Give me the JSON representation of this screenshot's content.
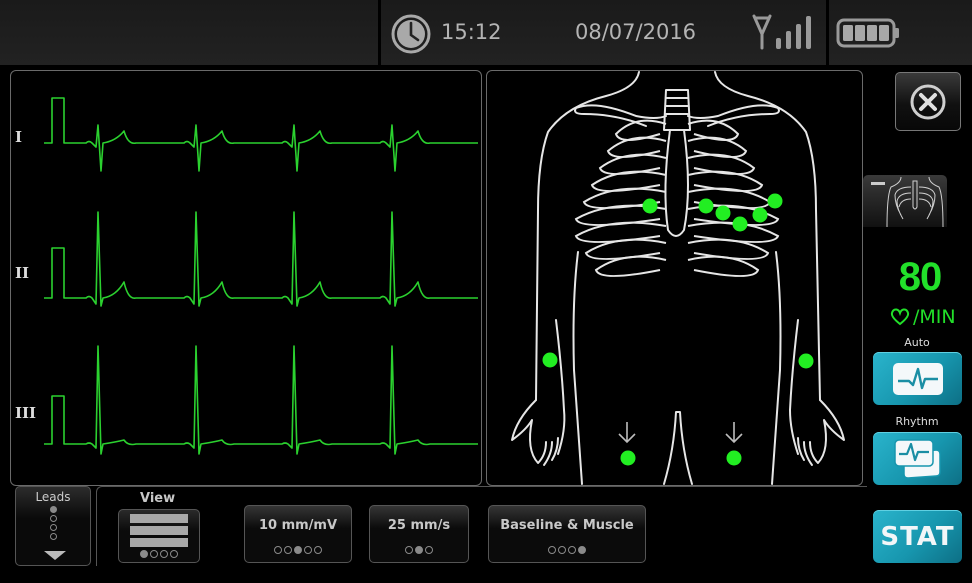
{
  "status_bar": {
    "time": "15:12",
    "date": "08/07/2016",
    "icons": [
      "clock-icon",
      "signal-icon",
      "battery-icon"
    ],
    "battery_level": 1.0,
    "signal_bars": 3
  },
  "leads_panel": {
    "leads": [
      {
        "label": "I"
      },
      {
        "label": "II"
      },
      {
        "label": "III"
      }
    ],
    "trace_color": "#2bd12f"
  },
  "body_panel": {
    "electrode_color": "#22ee22",
    "electrodes": [
      "RA",
      "LA",
      "V1",
      "V2",
      "V3",
      "V4",
      "V5",
      "V6",
      "RL",
      "LL"
    ]
  },
  "right_column": {
    "close_icon": "close-circle-icon",
    "heart_rate": "80",
    "heart_rate_unit": "/MIN",
    "auto_label": "Auto",
    "rhythm_label": "Rhythm",
    "stat_label": "STAT",
    "accent_color": "#1a9fb8"
  },
  "bottom_controls": {
    "leads": {
      "label": "Leads",
      "dot_count": 4,
      "selected_index": 0
    },
    "view": {
      "label": "View",
      "dot_count": 4,
      "selected_index": 0
    },
    "gain": {
      "label": "10 mm/mV",
      "dot_count": 5,
      "selected_index": 2
    },
    "speed": {
      "label": "25 mm/s",
      "dot_count": 3,
      "selected_index": 1
    },
    "filter": {
      "label": "Baseline & Muscle",
      "dot_count": 4,
      "selected_index": 3
    }
  }
}
